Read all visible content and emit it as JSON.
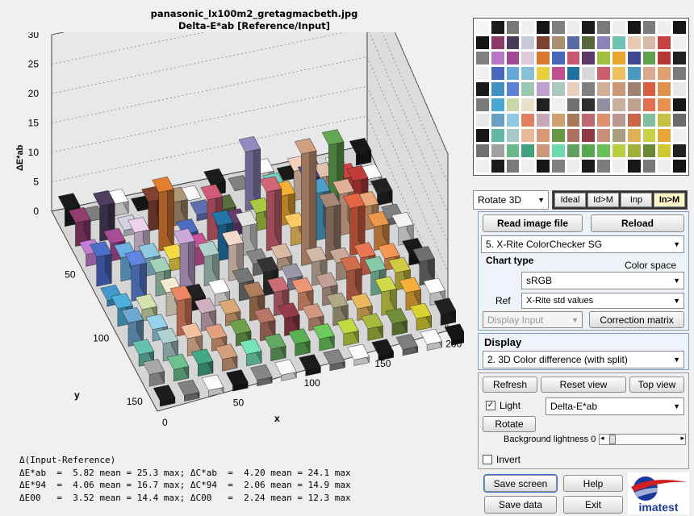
{
  "plot": {
    "title_line1": "panasonic_lx100m2_gretagmacbeth.jpg",
    "title_line2": "Delta-E*ab  [Reference/Input]",
    "z_axis_label": "ΔE*ab",
    "z_ticks": [
      "0",
      "5",
      "10",
      "15",
      "20",
      "25",
      "30"
    ],
    "y_axis_label": "y",
    "y_ticks": [
      "50",
      "100",
      "150"
    ],
    "x_axis_label": "x",
    "x_ticks": [
      "0",
      "50",
      "100",
      "150",
      "200"
    ]
  },
  "stats": {
    "header": "Δ(Input-Reference)",
    "line1": "ΔE*ab  =  5.82 mean = 25.3 max; ΔC*ab  =  4.20 mean = 24.1 max",
    "line2": "ΔE*94  =  4.06 mean = 16.7 max; ΔC*94  =  2.06 mean = 14.9 max",
    "line3": "ΔE00   =  3.52 mean = 14.4 max; ΔC00   =  2.24 mean = 12.3 max"
  },
  "swatches": {
    "colors": [
      "#f5f5f5",
      "#1a1a1a",
      "#787878",
      "#f0f0f0",
      "#141414",
      "#808080",
      "#ececec",
      "#1c1c1c",
      "#7a7a7a",
      "#eeeeee",
      "#181818",
      "#7c7c7c",
      "#efefef",
      "#171717",
      "#151515",
      "#8c3a6a",
      "#4a3a5a",
      "#c8c8d8",
      "#7a4030",
      "#a89070",
      "#5a6aa8",
      "#58683a",
      "#8a84b8",
      "#6ec4b4",
      "#e8c8b0",
      "#d8b8a8",
      "#c84040",
      "#f0f0f0",
      "#808080",
      "#b878c8",
      "#a04890",
      "#e0c8e0",
      "#d87830",
      "#4a68b8",
      "#c85870",
      "#5e3a68",
      "#a0c040",
      "#e8a830",
      "#404890",
      "#60a050",
      "#b83838",
      "#202020",
      "#f0f0f0",
      "#4868c0",
      "#68a8d8",
      "#88c0d8",
      "#e8d040",
      "#c05090",
      "#2070a0",
      "#d8d8d8",
      "#c86070",
      "#f0c060",
      "#4898c0",
      "#d8a890",
      "#e0a070",
      "#7a7a7a",
      "#1a1a1a",
      "#4090c0",
      "#5a80d8",
      "#9ac8b0",
      "#c0a0d0",
      "#a8c8c0",
      "#e8d0c0",
      "#808080",
      "#d0b098",
      "#c89878",
      "#a08070",
      "#d86040",
      "#e09048",
      "#e8e8e8",
      "#7a7a7a",
      "#48a8d0",
      "#c8d8a8",
      "#e8e0c8",
      "#202020",
      "#f0f0f0",
      "#707070",
      "#303030",
      "#9090a0",
      "#c8b0a0",
      "#c0a090",
      "#e07050",
      "#e89050",
      "#181818",
      "#e8e8e8",
      "#6aa0c8",
      "#90c8e0",
      "#e08060",
      "#c8a8b8",
      "#d0a070",
      "#a87858",
      "#c06870",
      "#e09070",
      "#b89890",
      "#c86848",
      "#80c0a0",
      "#c8c040",
      "#6a6a6a",
      "#181818",
      "#60b8a8",
      "#a8c8c8",
      "#e8b898",
      "#d89878",
      "#6a9848",
      "#b07060",
      "#903848",
      "#c89078",
      "#a8a080",
      "#e0b058",
      "#c8d048",
      "#e8a838",
      "#f0f0f0",
      "#707070",
      "#a0a0a0",
      "#68b888",
      "#40a080",
      "#c89878",
      "#70d8b0",
      "#60a060",
      "#58a850",
      "#68c058",
      "#b8d040",
      "#a0b038",
      "#6a8838",
      "#d0c830",
      "#202020",
      "#f0f0f0",
      "#1c1c1c",
      "#7a7a7a",
      "#f0f0f0",
      "#161616",
      "#808080",
      "#ececec",
      "#1a1a1a",
      "#7c7c7c",
      "#efefef",
      "#181818",
      "#787878",
      "#eeeeee",
      "#141414"
    ]
  },
  "controls": {
    "rotate_select": "Rotate 3D",
    "seg_ideal": "Ideal",
    "seg_idm": "Id>M",
    "seg_inp": "Inp",
    "seg_inm": "In>M",
    "read_image": "Read image file",
    "reload": "Reload",
    "chart_select": "5.  X-Rite ColorChecker SG",
    "chart_type_label": "Chart type",
    "color_space_label": "Color space",
    "color_space_value": "sRGB",
    "ref_label": "Ref",
    "ref_value": "X-Rite std values",
    "display_input_value": "Display Input",
    "correction_matrix": "Correction matrix",
    "display_label": "Display",
    "display_value": "2.  3D Color difference (with split)",
    "refresh": "Refresh",
    "reset_view": "Reset view",
    "top_view": "Top view",
    "light_label": "Light",
    "delta_select": "Delta-E*ab",
    "rotate_button": "Rotate",
    "bg_lightness_label": "Background lightness 0",
    "invert_label": "Invert",
    "save_screen": "Save screen",
    "help": "Help",
    "save_data": "Save data",
    "exit": "Exit",
    "logo_text": "imatest"
  },
  "bar_heights": [
    [
      3,
      0,
      2,
      0,
      0,
      0,
      2,
      0,
      2,
      0,
      0,
      0,
      2
    ],
    [
      4,
      6,
      1,
      5,
      4,
      1,
      1,
      10,
      3,
      5,
      3,
      2,
      1
    ],
    [
      2,
      3,
      4,
      10,
      2,
      7,
      2,
      3,
      5,
      7,
      12,
      5,
      2
    ],
    [
      5,
      4,
      3,
      2,
      3,
      6,
      5,
      10,
      3,
      8,
      7,
      4,
      1
    ],
    [
      1,
      6,
      4,
      8,
      5,
      6,
      2,
      2,
      19,
      9,
      8,
      4,
      3
    ],
    [
      3,
      2,
      4,
      2,
      2,
      3,
      4,
      2,
      4,
      3,
      3,
      2,
      2
    ],
    [
      4,
      2,
      6,
      3,
      2,
      4,
      4,
      3,
      3,
      5,
      4,
      3,
      4
    ],
    [
      2,
      3,
      3,
      2,
      2,
      3,
      3,
      2,
      3,
      2,
      4,
      3,
      2
    ],
    [
      2,
      2,
      2,
      2,
      2,
      2,
      2,
      2,
      2,
      2,
      2,
      2,
      2
    ],
    [
      1,
      1,
      1,
      1,
      1,
      1,
      1,
      1,
      1,
      1,
      1,
      1,
      1
    ]
  ]
}
